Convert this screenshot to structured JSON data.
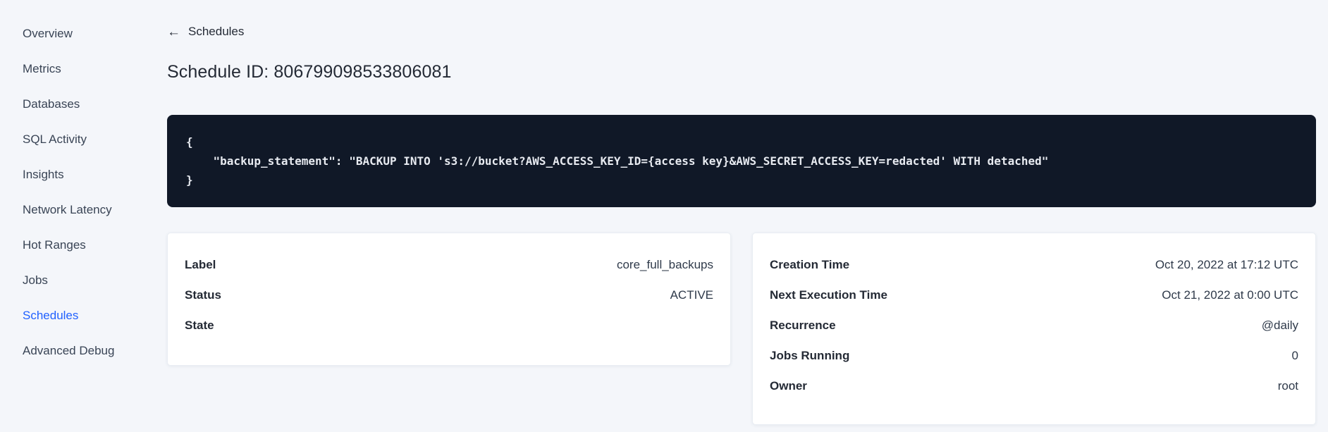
{
  "sidebar": {
    "items": [
      {
        "label": "Overview",
        "active": false
      },
      {
        "label": "Metrics",
        "active": false
      },
      {
        "label": "Databases",
        "active": false
      },
      {
        "label": "SQL Activity",
        "active": false
      },
      {
        "label": "Insights",
        "active": false
      },
      {
        "label": "Network Latency",
        "active": false
      },
      {
        "label": "Hot Ranges",
        "active": false
      },
      {
        "label": "Jobs",
        "active": false
      },
      {
        "label": "Schedules",
        "active": true
      },
      {
        "label": "Advanced Debug",
        "active": false
      }
    ]
  },
  "header": {
    "back_icon": "←",
    "back_label": "Schedules",
    "title": "Schedule ID: 806799098533806081"
  },
  "code_block": {
    "lines": [
      "{",
      "    \"backup_statement\": \"BACKUP INTO 's3://bucket?AWS_ACCESS_KEY_ID={access key}&AWS_SECRET_ACCESS_KEY=redacted' WITH detached\"",
      "}"
    ]
  },
  "cards": {
    "left": {
      "rows": [
        {
          "label": "Label",
          "value": "core_full_backups"
        },
        {
          "label": "Status",
          "value": "ACTIVE"
        },
        {
          "label": "State",
          "value": ""
        }
      ]
    },
    "right": {
      "rows": [
        {
          "label": "Creation Time",
          "value": "Oct 20, 2022 at 17:12 UTC"
        },
        {
          "label": "Next Execution Time",
          "value": "Oct 21, 2022 at 0:00 UTC"
        },
        {
          "label": "Recurrence",
          "value": "@daily"
        },
        {
          "label": "Jobs Running",
          "value": "0"
        },
        {
          "label": "Owner",
          "value": "root"
        }
      ]
    }
  },
  "colors": {
    "page_background": "#f4f6fa",
    "accent_blue": "#2161ff",
    "code_background": "#101827",
    "code_text": "#e7eaf0",
    "text_dark": "#242a35",
    "card_background": "#ffffff"
  }
}
